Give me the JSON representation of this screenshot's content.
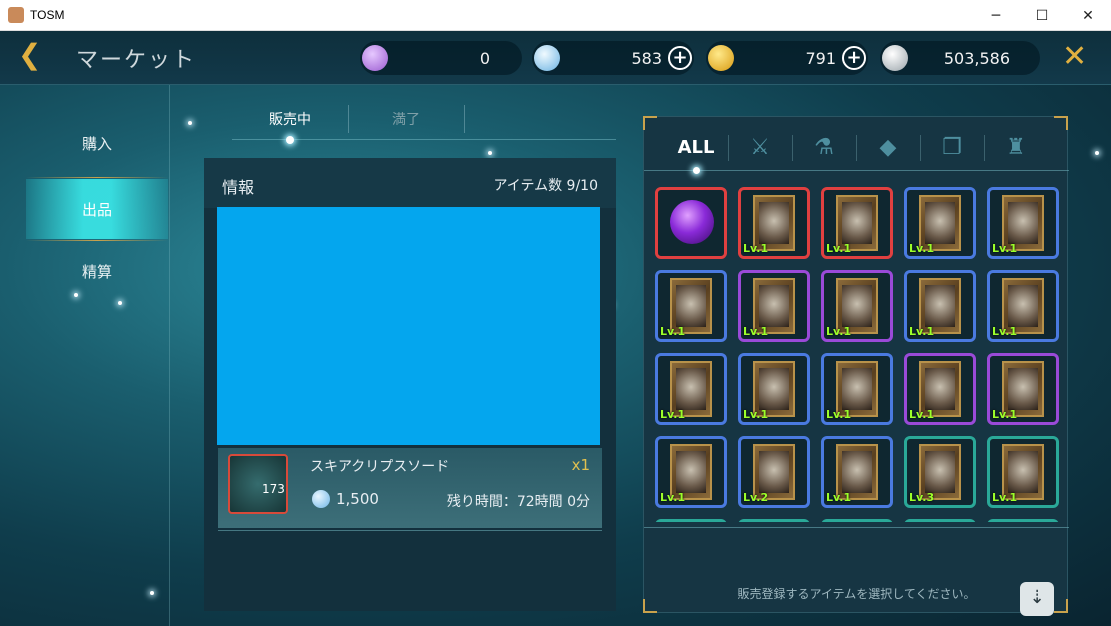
{
  "window": {
    "title": "TOSM",
    "minimize_icon": "─",
    "maximize_icon": "☐",
    "close_icon": "✕"
  },
  "topbar": {
    "back_icon": "❮",
    "title": "マーケット",
    "currencies": [
      {
        "name": "tp-coin",
        "value": "0",
        "color": "#b07ad8"
      },
      {
        "name": "diamond",
        "value": "583",
        "color": "#8ccff2",
        "has_plus": true
      },
      {
        "name": "gold",
        "value": "791",
        "color": "#f0b830",
        "has_plus": true
      },
      {
        "name": "silver",
        "value": "503,586",
        "color": "#d8dde0"
      }
    ],
    "plus_label": "+",
    "close_icon": "✕"
  },
  "sidebar": {
    "items": [
      {
        "label": "購入"
      },
      {
        "label": "出品"
      },
      {
        "label": "精算"
      }
    ],
    "active": "出品"
  },
  "tabs": [
    {
      "label": "販売中"
    },
    {
      "label": "満了"
    }
  ],
  "info": {
    "title": "情報",
    "count_label": "アイテム数 9/10",
    "item": {
      "level": "173",
      "name": "スキアクリプスソード",
      "qty": "x1",
      "price": "1,500",
      "time_left": "残り時間：72時間 0分"
    }
  },
  "inventory": {
    "filters": [
      {
        "label": "ALL"
      },
      {
        "icon": "crossed-swords-icon",
        "glyph": "⚔"
      },
      {
        "icon": "potion-icon",
        "glyph": "⚗"
      },
      {
        "icon": "gem-icon",
        "glyph": "◆"
      },
      {
        "icon": "cards-icon",
        "glyph": "❐"
      },
      {
        "icon": "dress-icon",
        "glyph": "♜"
      }
    ],
    "slots": [
      {
        "border": "red",
        "kind": "orb",
        "lv": ""
      },
      {
        "border": "red",
        "kind": "card",
        "lv": "Lv.1"
      },
      {
        "border": "red",
        "kind": "card",
        "lv": "Lv.1"
      },
      {
        "border": "blue",
        "kind": "card",
        "lv": "Lv.1"
      },
      {
        "border": "blue",
        "kind": "card",
        "lv": "Lv.1"
      },
      {
        "border": "blue",
        "kind": "card",
        "lv": "Lv.1"
      },
      {
        "border": "purple",
        "kind": "card",
        "lv": "Lv.1"
      },
      {
        "border": "purple",
        "kind": "card",
        "lv": "Lv.1"
      },
      {
        "border": "blue",
        "kind": "card",
        "lv": "Lv.1"
      },
      {
        "border": "blue",
        "kind": "card",
        "lv": "Lv.1"
      },
      {
        "border": "blue",
        "kind": "card",
        "lv": "Lv.1"
      },
      {
        "border": "blue",
        "kind": "card",
        "lv": "Lv.1"
      },
      {
        "border": "blue",
        "kind": "card",
        "lv": "Lv.1"
      },
      {
        "border": "purple",
        "kind": "card",
        "lv": "Lv.1"
      },
      {
        "border": "purple",
        "kind": "card",
        "lv": "Lv.1"
      },
      {
        "border": "blue",
        "kind": "card",
        "lv": "Lv.1"
      },
      {
        "border": "blue",
        "kind": "card",
        "lv": "Lv.2"
      },
      {
        "border": "blue",
        "kind": "card",
        "lv": "Lv.1"
      },
      {
        "border": "green",
        "kind": "card",
        "lv": "Lv.3"
      },
      {
        "border": "green",
        "kind": "card",
        "lv": "Lv.1"
      },
      {
        "border": "green",
        "kind": "card",
        "lv": ""
      },
      {
        "border": "green",
        "kind": "card",
        "lv": ""
      },
      {
        "border": "green",
        "kind": "card",
        "lv": ""
      },
      {
        "border": "green",
        "kind": "card",
        "lv": ""
      },
      {
        "border": "green",
        "kind": "card",
        "lv": ""
      }
    ],
    "message": "販売登録するアイテムを選択してください。",
    "sort_icon": "⇣"
  }
}
